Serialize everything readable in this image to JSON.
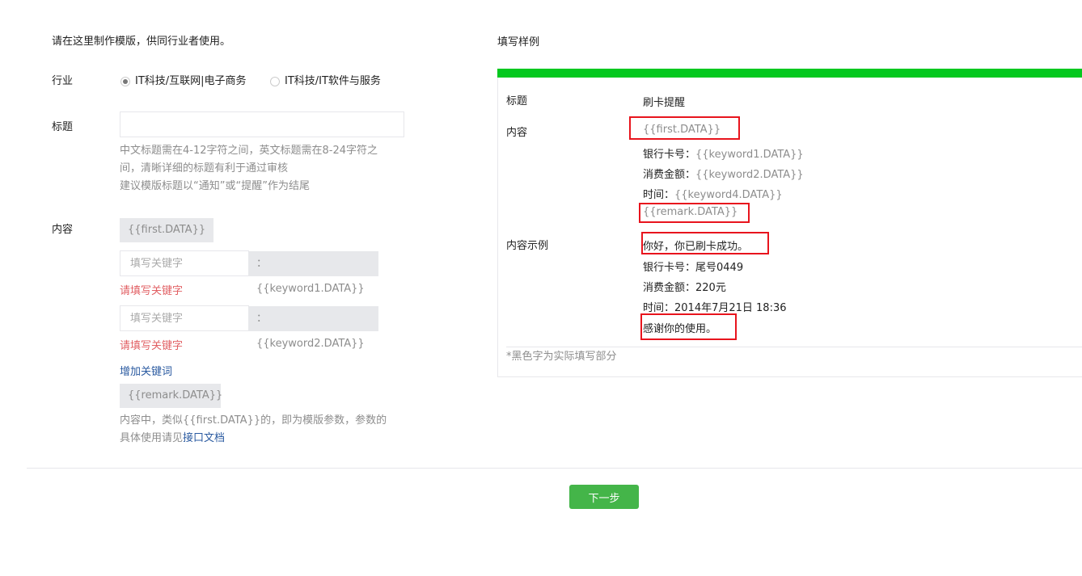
{
  "intro": "请在这里制作模版，供同行业者使用。",
  "industry": {
    "label": "行业",
    "options": [
      {
        "label": "IT科技/互联网|电子商务",
        "selected": true
      },
      {
        "label": "IT科技/IT软件与服务",
        "selected": false
      }
    ]
  },
  "title_field": {
    "label": "标题",
    "value": "",
    "hint1": "中文标题需在4-12字符之间，英文标题需在8-24字符之",
    "hint2": "间，清晰详细的标题有利于通过审核",
    "hint3": "建议模版标题以“通知”或“提醒”作为结尾"
  },
  "content": {
    "label": "内容",
    "first": "{{first.DATA}}",
    "keywords": [
      {
        "placeholder": "填写关键字",
        "value": "",
        "param": "：{{keyword1.DATA}}",
        "error": "请填写关键字"
      },
      {
        "placeholder": "填写关键字",
        "value": "",
        "param": "：{{keyword2.DATA}}",
        "error": "请填写关键字"
      }
    ],
    "add_keyword": "增加关键词",
    "remark": "{{remark.DATA}}",
    "note1": "内容中，类似{{first.DATA}}的，即为模版参数，参数的",
    "note2a": "具体使用请见",
    "note2_link": "接口文档"
  },
  "example": {
    "heading": "填写样例",
    "title_label": "标题",
    "title_value": "刷卡提醒",
    "content_label": "内容",
    "first": "{{first.DATA}}",
    "lines": [
      {
        "k": "银行卡号：",
        "v": "{{keyword1.DATA}}"
      },
      {
        "k": "消费金额：",
        "v": "{{keyword2.DATA}}"
      },
      {
        "k": "时间：",
        "v": "{{keyword4.DATA}}"
      }
    ],
    "remark": "{{remark.DATA}}",
    "sample_label": "内容示例",
    "sample_first": "你好，你已刷卡成功。",
    "sample_lines": [
      "银行卡号：尾号0449",
      "消费金额：220元",
      "时间：2014年7月21日 18:36"
    ],
    "sample_remark": "感谢你的使用。",
    "footnote": "*黑色字为实际填写部分"
  },
  "next_button": "下一步",
  "colors": {
    "accent": "#44b549",
    "bar": "#04c81f",
    "error": "#e15f63",
    "highlight": "#e8141d"
  }
}
